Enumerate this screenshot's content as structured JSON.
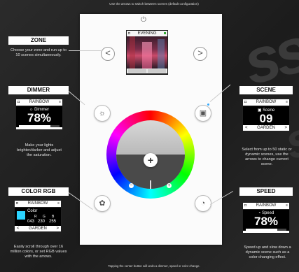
{
  "top_caption": "Use the arrows to switch between scenes (default configuration)",
  "bottom_caption": "Tapping the center button will undo a dimmer, speed or color change.",
  "device": {
    "screen_title": "EVENING",
    "prev_symbol": "<",
    "next_symbol": ">",
    "center_symbol": "+",
    "minus_symbol": "−",
    "plus_symbol": "+"
  },
  "zone": {
    "title": "ZONE",
    "desc": "Choose your zone and run up to 10 scenes simultaneously."
  },
  "dimmer": {
    "title": "DIMMER",
    "lcd_header": "RAINBOW",
    "sub": "☼ Dimmer",
    "value": "78%",
    "level": 0.78,
    "desc": "Make your lights brighter/darker and adjust the saturation."
  },
  "scene": {
    "title": "SCENE",
    "lcd_header": "RAINBOW",
    "sub": "Scene",
    "value": "09",
    "nav_label": "GARDEN",
    "desc": "Select from up to 50 static or dynamic scenes, use the arrows to change current scene."
  },
  "color": {
    "title": "COLOR RGB",
    "lcd_header": "RAINBOW",
    "sub": "Color",
    "r_label": "R",
    "g_label": "G",
    "b_label": "B",
    "r": "043",
    "g": "230",
    "b": "255",
    "nav_label": "GARDEN",
    "swatch_color": "#2bd3ff",
    "desc": "Easily scroll through over 16 million colors, or set RGB values with the arrows."
  },
  "speed": {
    "title": "SPEED",
    "lcd_header": "RAINBOW",
    "sub": "Speed",
    "value": "78%",
    "level": 0.78,
    "desc": "Speed up and slow down a dynamic scene such as a color changing effect."
  }
}
